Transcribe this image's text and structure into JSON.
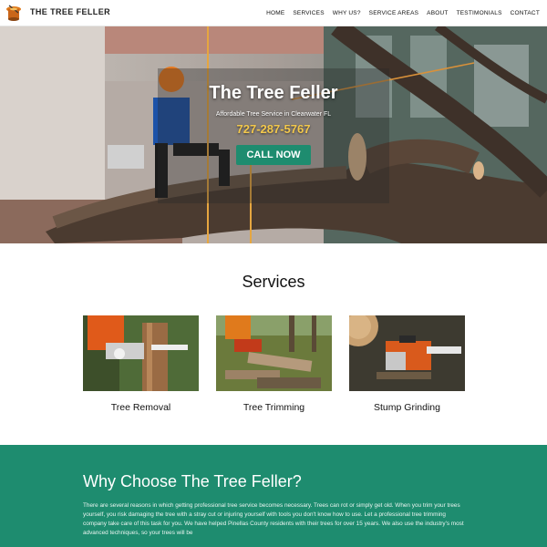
{
  "header": {
    "brand": "THE TREE FELLER",
    "logo_icon": "tree-stump-logo-icon",
    "nav": [
      "HOME",
      "SERVICES",
      "WHY US?",
      "SERVICE AREAS",
      "ABOUT",
      "TESTIMONIALS",
      "CONTACT"
    ]
  },
  "hero": {
    "title": "The Tree Feller",
    "subtitle": "Affordable Tree Service in Clearwater FL",
    "phone": "727-287-5767",
    "cta": "CALL NOW"
  },
  "services": {
    "title": "Services",
    "items": [
      {
        "label": "Tree Removal"
      },
      {
        "label": "Tree Trimming"
      },
      {
        "label": "Stump Grinding"
      }
    ]
  },
  "why": {
    "title": "Why Choose The Tree Feller?",
    "body": "There are several reasons in which getting professional tree service becomes necessary. Trees can rot or simply get old. When you trim your trees yourself, you risk damaging the tree with a stray cut or injuring yourself with tools you don't know how to use. Let a professional tree trimming company take care of this task for you. We have helped Pinellas County residents with their trees for over 15 years. We also use the industry's most advanced techniques, so your trees will be"
  },
  "colors": {
    "accent": "#1e8c6f",
    "phone": "#f3c84c"
  }
}
